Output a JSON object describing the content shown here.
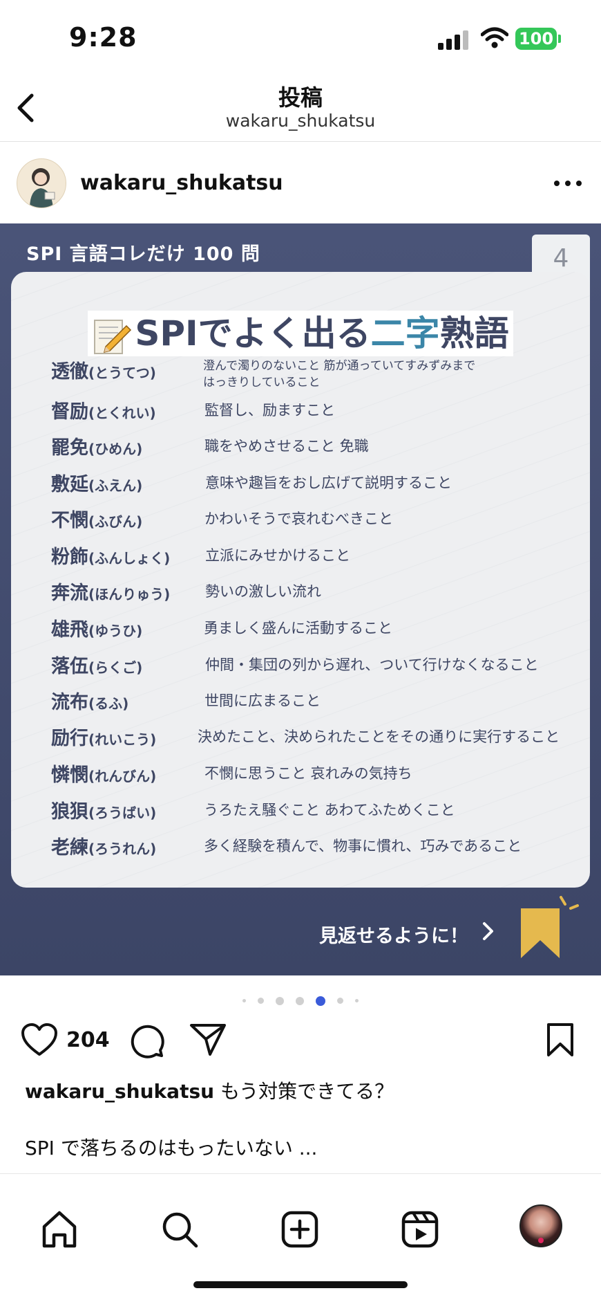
{
  "status_bar": {
    "time": "9:28",
    "battery": "100"
  },
  "header": {
    "title": "投稿",
    "subtitle": "wakaru_shukatsu"
  },
  "post": {
    "username": "wakaru_shukatsu",
    "image": {
      "series_title": "SPI 言語コレだけ 100 問",
      "page_number": "4",
      "heading_part1": "SPIでよく出る",
      "heading_part2": "二字",
      "heading_part3": "熟語",
      "rows": [
        {
          "word": "透徹",
          "reading": "(とうてつ)",
          "meaning": "澄んで濁りのないこと  筋が通っていてすみずみまで",
          "meaning2": "はっきりしていること"
        },
        {
          "word": "督励",
          "reading": "(とくれい)",
          "meaning": "監督し、励ますこと"
        },
        {
          "word": "罷免",
          "reading": "(ひめん)",
          "meaning": "職をやめさせること  免職"
        },
        {
          "word": "敷延",
          "reading": "(ふえん)",
          "meaning": "意味や趣旨をおし広げて説明すること"
        },
        {
          "word": "不憫",
          "reading": "(ふびん)",
          "meaning": "かわいそうで哀れむべきこと"
        },
        {
          "word": "粉飾",
          "reading": "(ふんしょく)",
          "meaning": "立派にみせかけること"
        },
        {
          "word": "奔流",
          "reading": "(ほんりゅう)",
          "meaning": "勢いの激しい流れ"
        },
        {
          "word": "雄飛",
          "reading": "(ゆうひ)",
          "meaning": "勇ましく盛んに活動すること"
        },
        {
          "word": "落伍",
          "reading": "(らくご)",
          "meaning": "仲間・集団の列から遅れ、ついて行けなくなること"
        },
        {
          "word": "流布",
          "reading": "(るふ)",
          "meaning": "世間に広まること"
        },
        {
          "word": "励行",
          "reading": "(れいこう)",
          "meaning": "決めたこと、決められたことをその通りに実行すること"
        },
        {
          "word": "憐憫",
          "reading": "(れんびん)",
          "meaning": "不憫に思うこと  哀れみの気持ち"
        },
        {
          "word": "狼狽",
          "reading": "(ろうばい)",
          "meaning": "うろたえ騒ぐこと  あわてふためくこと"
        },
        {
          "word": "老練",
          "reading": "(ろうれん)",
          "meaning": "多く経験を積んで、物事に慣れ、巧みであること"
        }
      ],
      "cta": "見返せるように！",
      "colors": {
        "background": "#434c6e",
        "accent_blue": "#3b86a8",
        "bookmark_gold": "#e5b94e"
      }
    },
    "carousel": {
      "total_dots": 7,
      "active_index": 4
    },
    "likes": "204",
    "caption_user": "wakaru_shukatsu",
    "caption_text": "もう対策できてる？",
    "caption_line2": "SPI で落ちるのはもったいない ..."
  },
  "tab_bar": {
    "items": [
      "home-icon",
      "search-icon",
      "create-icon",
      "reels-icon",
      "profile-avatar"
    ]
  }
}
